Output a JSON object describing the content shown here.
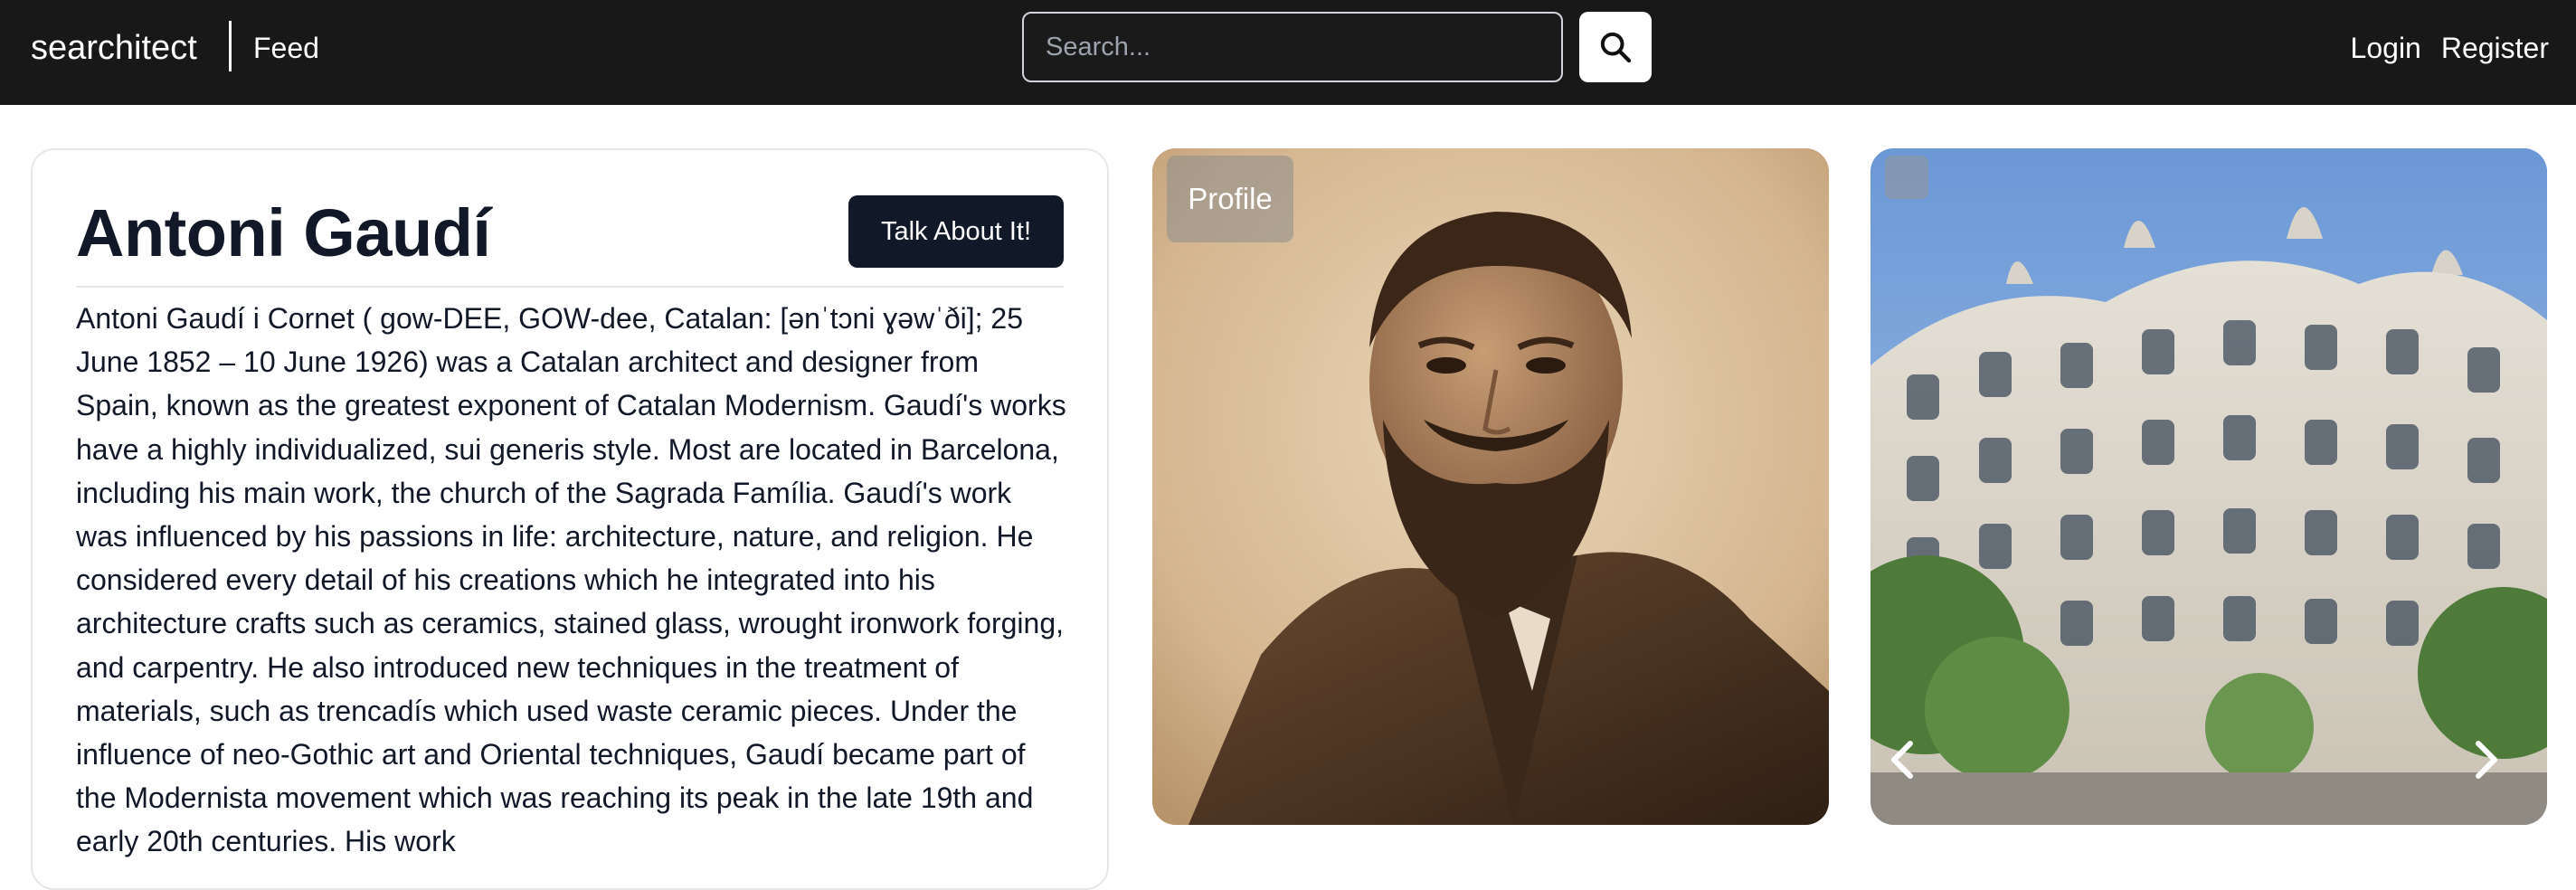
{
  "navbar": {
    "brand": "searchitect",
    "feed_link": "Feed",
    "search_placeholder": "Search...",
    "search_icon": "search-icon",
    "login": "Login",
    "register": "Register",
    "background_color": "#181818"
  },
  "profile": {
    "title": "Antoni Gaudí",
    "talk_button": "Talk About It!",
    "bio": "Antoni Gaudí i Cornet ( gow-DEE, GOW-dee, Catalan: [ənˈtɔni ɣəwˈði]; 25 June 1852 – 10 June 1926) was a Catalan architect and designer from Spain, known as the greatest exponent of Catalan Modernism. Gaudí's works have a highly individualized, sui generis style. Most are located in Barcelona, including his main work, the church of the Sagrada Família. Gaudí's work was influenced by his passions in life: architecture, nature, and religion. He considered every detail of his creations which he integrated into his architecture crafts such as ceramics, stained glass, wrought ironwork forging, and carpentry. He also introduced new techniques in the treatment of materials, such as trencadís which used waste ceramic pieces. Under the influence of neo-Gothic art and Oriental techniques, Gaudí became part of the Modernista movement which was reaching its peak in the late 19th and early 20th centuries. His work"
  },
  "gallery": {
    "profile_badge": "Profile",
    "prev_icon": "chevron-left-icon",
    "next_icon": "chevron-right-icon",
    "button_color": "#111827"
  }
}
